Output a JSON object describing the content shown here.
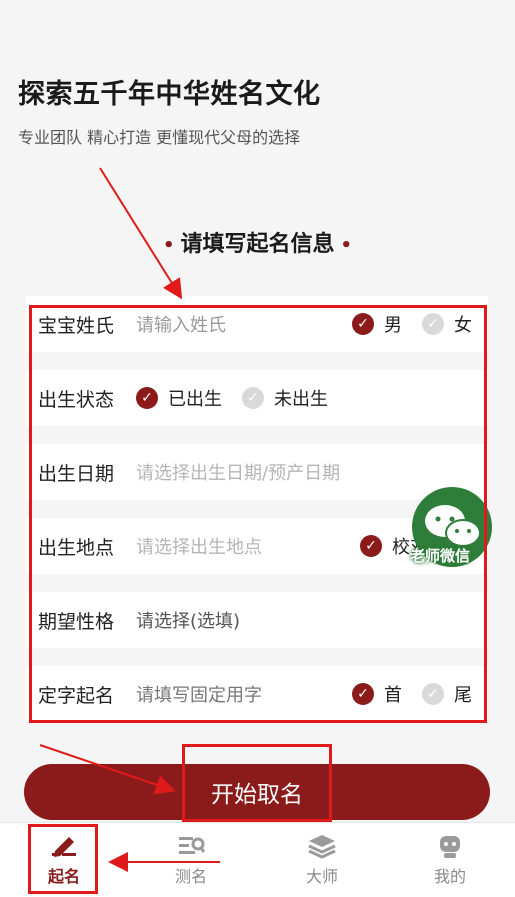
{
  "header": {
    "title": "探索五千年中华姓名文化",
    "subtitle": "专业团队 精心打造 更懂现代父母的选择"
  },
  "section_title": "请填写起名信息",
  "form": {
    "surname": {
      "label": "宝宝姓氏",
      "placeholder": "请输入姓氏",
      "opt1": "男",
      "opt2": "女"
    },
    "birth_status": {
      "label": "出生状态",
      "opt1": "已出生",
      "opt2": "未出生"
    },
    "birth_date": {
      "label": "出生日期",
      "placeholder": "请选择出生日期/预产日期"
    },
    "birth_place": {
      "label": "出生地点",
      "placeholder": "请选择出生地点",
      "opt1": "校对"
    },
    "personality": {
      "label": "期望性格",
      "placeholder": "请选择(选填)"
    },
    "fixed_char": {
      "label": "定字起名",
      "placeholder": "请填写固定用字",
      "opt1": "首",
      "opt2": "尾"
    }
  },
  "wechat_badge": "老师微信",
  "start_button": "开始取名",
  "tabs": [
    {
      "label": "起名",
      "icon": "pen-icon"
    },
    {
      "label": "测名",
      "icon": "search-list-icon"
    },
    {
      "label": "大师",
      "icon": "layers-icon"
    },
    {
      "label": "我的",
      "icon": "robot-icon"
    }
  ],
  "colors": {
    "accent": "#8b1a1a",
    "annotation": "#e01a1a",
    "wechat": "#2e7d3a"
  }
}
